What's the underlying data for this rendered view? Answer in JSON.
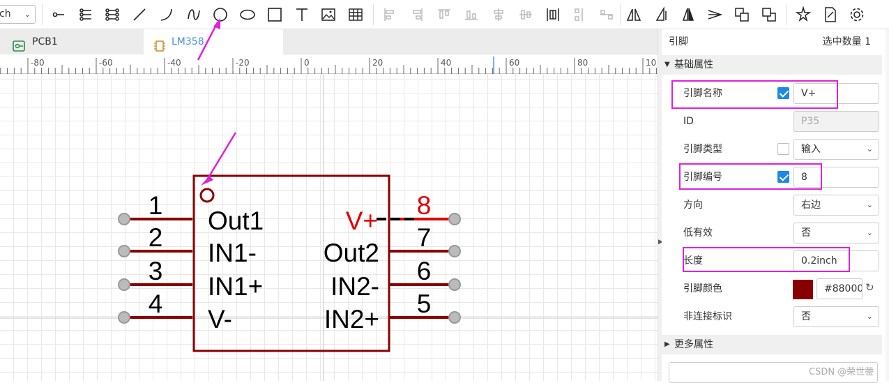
{
  "toolbar": {
    "unit_value": "ch",
    "tools": [
      "pin-tool",
      "bus-entry-tool",
      "pin-array-tool",
      "line-tool",
      "arc-tool",
      "bezier-tool",
      "circle-tool",
      "ellipse-tool",
      "rectangle-tool",
      "text-tool",
      "image-tool",
      "table-tool",
      "align-left-tool",
      "align-right-tool",
      "align-top-tool",
      "align-bottom-tool",
      "align-center-h-tool",
      "align-center-v-tool",
      "distribute-grid-tool",
      "distribute-h-tool",
      "distribute-v-tool",
      "flip-h-tool",
      "flip-v-tool",
      "mirror-tool",
      "rotate-tool",
      "bring-front-tool",
      "send-back-tool",
      "select-tool",
      "edit-tool",
      "settings-tool"
    ]
  },
  "tabs": [
    {
      "label": "PCB1",
      "icon": "pcb-icon"
    },
    {
      "label": "LM358",
      "icon": "chip-icon"
    }
  ],
  "ruler": {
    "labels": [
      "-80",
      "-60",
      "-40",
      "-20",
      "0",
      "20",
      "40",
      "60",
      "80",
      "10"
    ]
  },
  "symbol": {
    "left_pins": [
      {
        "number": "1",
        "name": "Out1"
      },
      {
        "number": "2",
        "name": "IN1-"
      },
      {
        "number": "3",
        "name": "IN1+"
      },
      {
        "number": "4",
        "name": "V-"
      }
    ],
    "right_pins": [
      {
        "number": "8",
        "name": "V+"
      },
      {
        "number": "7",
        "name": "Out2"
      },
      {
        "number": "6",
        "name": "IN2-"
      },
      {
        "number": "5",
        "name": "IN2+"
      }
    ],
    "colors": {
      "body": "#8b0000",
      "selected": "#e00000",
      "text": "#000000",
      "highlight": "#e020e0"
    }
  },
  "panel": {
    "title": "引脚",
    "selected_count": "选中数量   1",
    "section_basic": "基础属性",
    "section_more": "更多属性",
    "rows": {
      "pin_name": {
        "label": "引脚名称",
        "value": "V+"
      },
      "id": {
        "label": "ID",
        "value": "P35"
      },
      "pin_type": {
        "label": "引脚类型",
        "value": "输入"
      },
      "pin_number": {
        "label": "引脚编号",
        "value": "8"
      },
      "direction": {
        "label": "方向",
        "value": "右边"
      },
      "active_low": {
        "label": "低有效",
        "value": "否"
      },
      "length": {
        "label": "长度",
        "value": "0.2inch"
      },
      "pin_color": {
        "label": "引脚颜色",
        "value": "#88000"
      },
      "no_connect": {
        "label": "非连接标识",
        "value": "否"
      }
    }
  },
  "watermark": "CSDN @荣世蓥"
}
